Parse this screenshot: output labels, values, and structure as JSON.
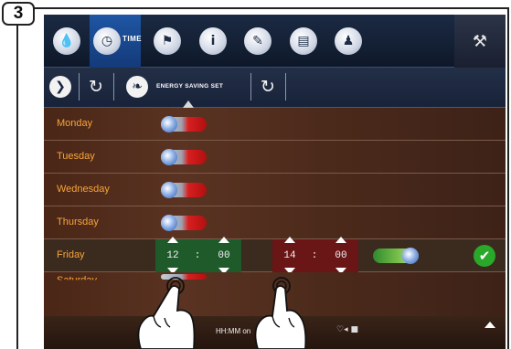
{
  "step": "3",
  "top_nav": {
    "time_label": "TIME",
    "icons": [
      "water-drop-icon",
      "clock-icon",
      "flag-icon",
      "info-icon",
      "edit-icon",
      "calendar-icon",
      "user-icon",
      "wrench-icon"
    ]
  },
  "sub_tabs": {
    "label": "ENERGY SAVING SET",
    "icons": [
      "next-icon",
      "clock-refresh-icon",
      "leaf-icon",
      "water-refresh-icon"
    ]
  },
  "days": [
    {
      "name": "Monday",
      "enabled": false
    },
    {
      "name": "Tuesday",
      "enabled": false
    },
    {
      "name": "Wednesday",
      "enabled": false
    },
    {
      "name": "Thursday",
      "enabled": false
    }
  ],
  "friday": {
    "name": "Friday",
    "start_hh": "12",
    "start_mm": "00",
    "end_hh": "14",
    "end_mm": "00",
    "separator": ":",
    "enabled": true
  },
  "partial_day": "Saturday",
  "bottom": {
    "hint": "HH:MM on",
    "status_icons": "♡◂ ■"
  },
  "colors": {
    "day_label": "#f7a43a",
    "start_box": "#1f5a2a",
    "end_box": "#6a1616",
    "confirm": "#2aa82a"
  }
}
